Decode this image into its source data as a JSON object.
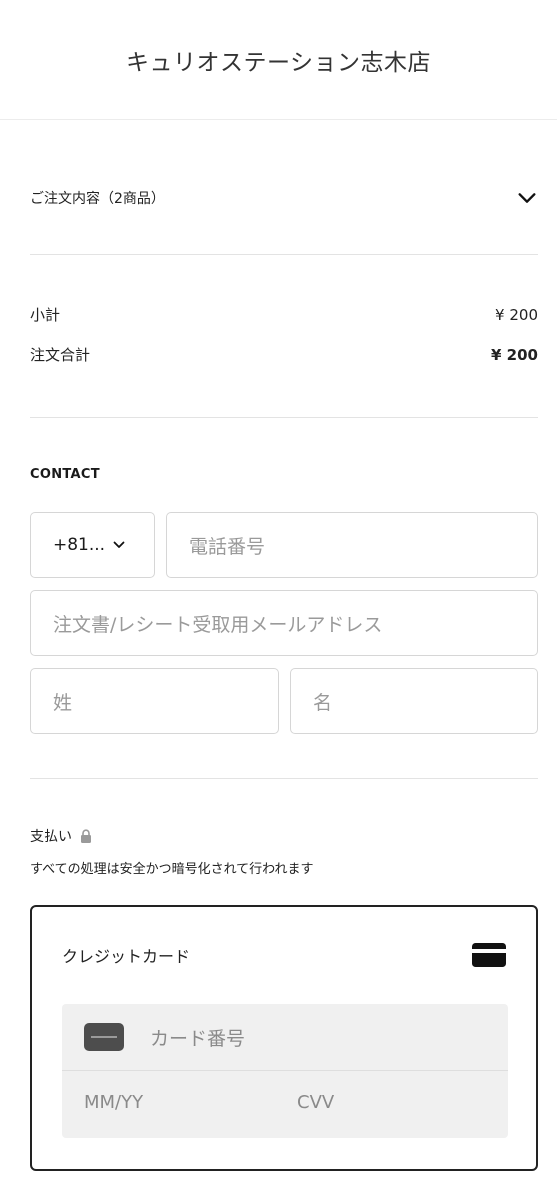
{
  "header": {
    "store_name": "キュリオステーション志木店"
  },
  "order_summary": {
    "toggle_label": "ご注文内容（2商品）"
  },
  "totals": {
    "subtotal_label": "小計",
    "subtotal_value": "¥ 200",
    "total_label": "注文合計",
    "total_value": "¥ 200"
  },
  "contact": {
    "title": "CONTACT",
    "country_code": "+81...",
    "phone_placeholder": "電話番号",
    "email_placeholder": "注文書/レシート受取用メールアドレス",
    "last_name_placeholder": "姓",
    "first_name_placeholder": "名"
  },
  "payment": {
    "title": "支払い",
    "subtitle": "すべての処理は安全かつ暗号化されて行われます",
    "method_label": "クレジットカード",
    "card_number_placeholder": "カード番号",
    "expiry_placeholder": "MM/YY",
    "cvv_placeholder": "CVV"
  },
  "icons": {
    "chevron": "chevron-down-icon",
    "lock": "lock-icon",
    "credit_card": "credit-card-icon"
  }
}
